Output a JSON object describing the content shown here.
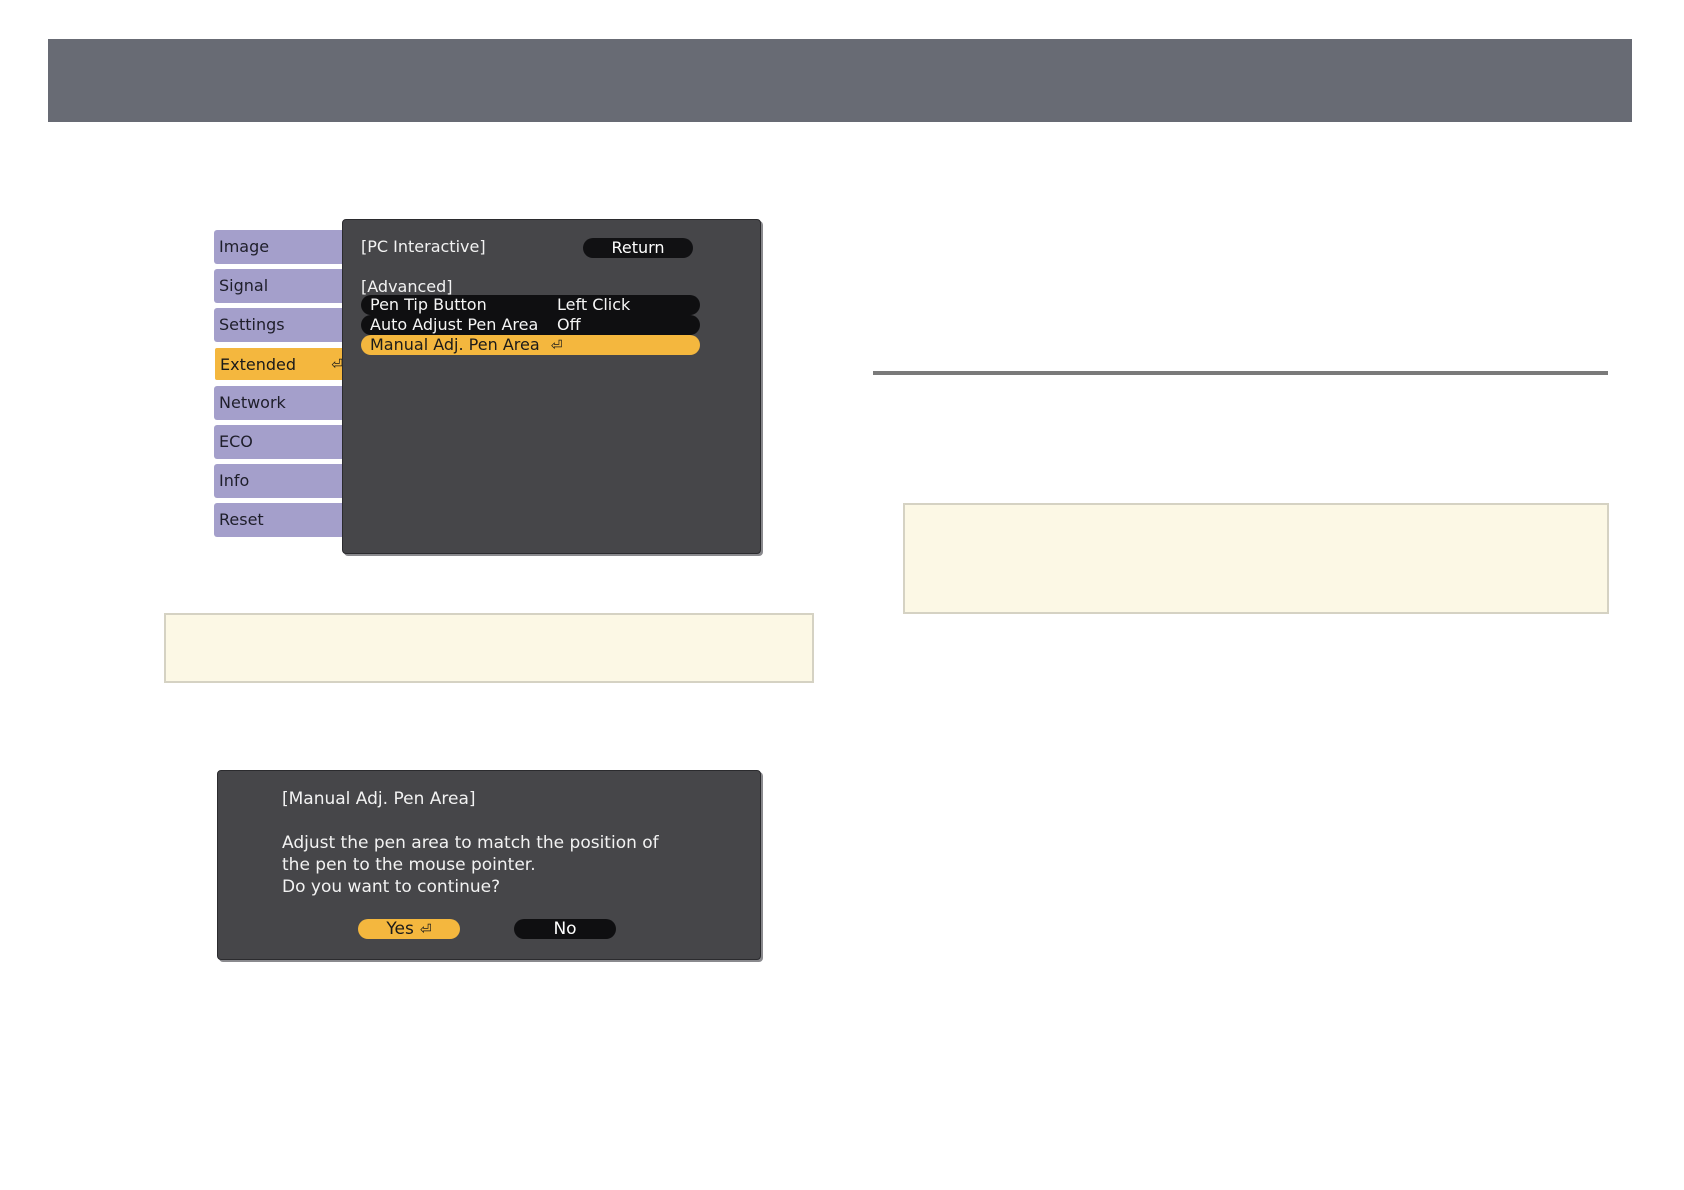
{
  "menu": {
    "tabs": [
      {
        "label": "Image"
      },
      {
        "label": "Signal"
      },
      {
        "label": "Settings"
      },
      {
        "label": "Extended"
      },
      {
        "label": "Network"
      },
      {
        "label": "ECO"
      },
      {
        "label": "Info"
      },
      {
        "label": "Reset"
      }
    ],
    "active_tab": "Extended",
    "panel_title": "[PC Interactive]",
    "return_label": "Return",
    "section_label": "[Advanced]",
    "rows": [
      {
        "label": "Pen Tip Button",
        "value": "Left Click"
      },
      {
        "label": "Auto Adjust Pen Area",
        "value": "Off"
      },
      {
        "label": "Manual Adj. Pen Area",
        "value": ""
      }
    ],
    "selected_row": "Manual Adj. Pen Area",
    "enter_icon": "enter-return-icon"
  },
  "dialog": {
    "title": "[Manual Adj. Pen Area]",
    "message_lines": [
      "Adjust the pen area to match the position of",
      "the pen to the mouse pointer.",
      "Do you want to continue?"
    ],
    "yes_label": "Yes",
    "no_label": "No"
  },
  "colors": {
    "header": "#686b74",
    "tab": "#a49fcb",
    "highlight": "#f4b73e",
    "panel": "#464649",
    "note_bg": "#fcf8e5"
  }
}
